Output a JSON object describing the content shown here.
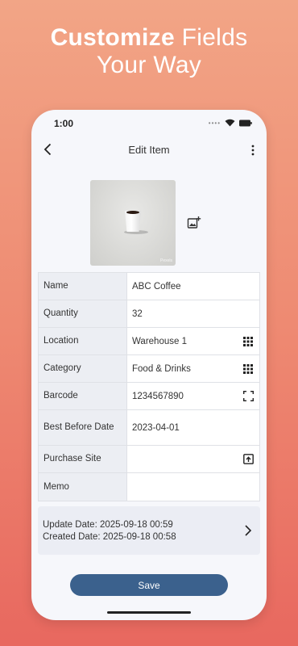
{
  "headline": {
    "bold": "Customize",
    "rest_line1": " Fields",
    "line2": "Your Way"
  },
  "status": {
    "time": "1:00"
  },
  "appbar": {
    "title": "Edit Item"
  },
  "photo": {
    "watermark": "Pexels"
  },
  "fields": [
    {
      "label": "Name",
      "value": "ABC Coffee",
      "icon": ""
    },
    {
      "label": "Quantity",
      "value": "32",
      "icon": ""
    },
    {
      "label": "Location",
      "value": "Warehouse 1",
      "icon": "grid-icon"
    },
    {
      "label": "Category",
      "value": "Food & Drinks",
      "icon": "grid-icon"
    },
    {
      "label": "Barcode",
      "value": "1234567890",
      "icon": "scan-icon"
    },
    {
      "label": "Best Before Date",
      "value": "2023-04-01",
      "icon": ""
    },
    {
      "label": "Purchase Site",
      "value": "",
      "icon": "open-link-icon"
    },
    {
      "label": "Memo",
      "value": "",
      "icon": ""
    }
  ],
  "dates": {
    "update": "Update Date: 2025-09-18 00:59",
    "created": "Created Date: 2025-09-18 00:58"
  },
  "save_label": "Save",
  "colors": {
    "accent": "#3b618d",
    "bg_top": "#f2a586",
    "bg_bottom": "#e8685f"
  }
}
